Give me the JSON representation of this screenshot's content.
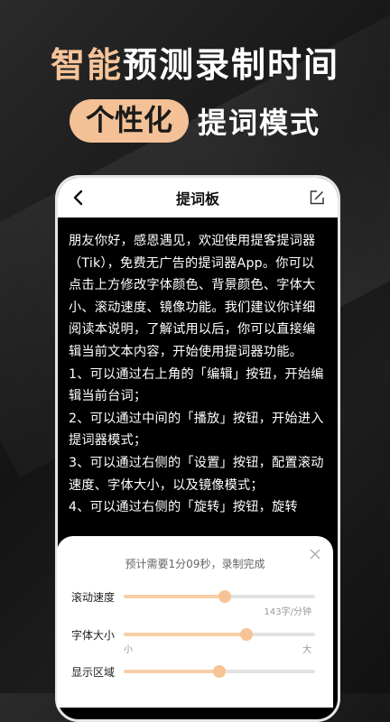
{
  "headline": {
    "line1_highlight": "智能",
    "line1_rest": "预测录制时间",
    "pill": "个性化",
    "line2_rest": "提词模式"
  },
  "topbar": {
    "title": "提词板",
    "back_icon": "chevron-left-icon",
    "edit_icon": "edit-icon"
  },
  "content": {
    "paragraphs": [
      "朋友你好，感恩遇见，欢迎使用提客提词器（Tik），免费无广告的提词器App。你可以点击上方修改字体颜色、背景颜色、字体大小、滚动速度、镜像功能。我们建议你详细阅读本说明，了解试用以后，你可以直接编辑当前文本内容，开始使用提词器功能。",
      "1、可以通过右上角的「编辑」按钮，开始编辑当前台词；",
      "2、可以通过中间的「播放」按钮，开始进入提词器模式；",
      "3、可以通过右侧的「设置」按钮，配置滚动速度、字体大小，以及镜像模式；",
      "4、可以通过右侧的「旋转」按钮，旋转"
    ]
  },
  "panel": {
    "hint": "预计需要1分09秒，录制完成",
    "speed_label": "滚动速度",
    "speed_value": "143字/分钟",
    "speed_level": 0.53,
    "font_label": "字体大小",
    "font_min": "小",
    "font_max": "大",
    "font_level": 0.64,
    "area_label": "显示区域",
    "area_level": 0.5
  },
  "colors": {
    "accent": "#f3c195",
    "headline_highlight": "#f6c49a"
  }
}
